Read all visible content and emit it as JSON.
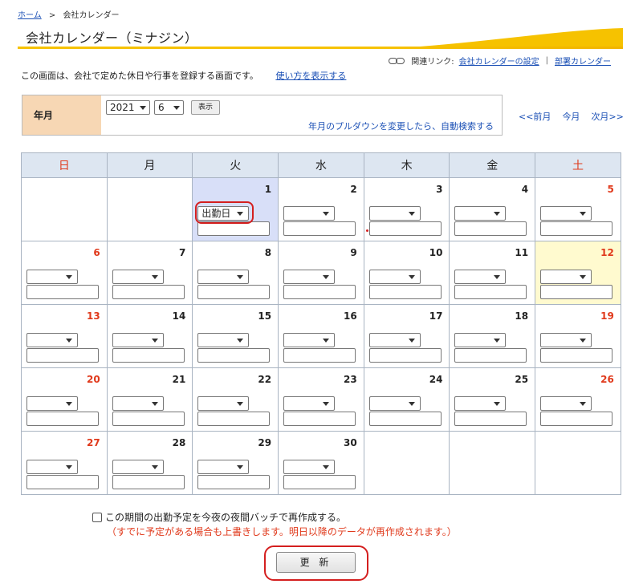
{
  "breadcrumb": {
    "home": "ホーム",
    "sep": ">",
    "current": "会社カレンダー"
  },
  "page_title": "会社カレンダー（ミナジン）",
  "related": {
    "label": "関連リンク:",
    "link1": "会社カレンダーの設定",
    "sep": "|",
    "link2": "部署カレンダー"
  },
  "description": {
    "text": "この画面は、会社で定めた休日や行事を登録する画面です。",
    "howto_link": "使い方を表示する"
  },
  "year_month": {
    "label": "年月",
    "year": "2021",
    "month": "6",
    "show_button": "表示",
    "hint": "年月のプルダウンを変更したら、自動検索する"
  },
  "nav": {
    "prev": "<<前月",
    "this": "今月",
    "next": "次月>>"
  },
  "weekdays": [
    "日",
    "月",
    "火",
    "水",
    "木",
    "金",
    "土"
  ],
  "weeks": [
    [
      {
        "day": ""
      },
      {
        "day": ""
      },
      {
        "day": "1",
        "status": "出勤日"
      },
      {
        "day": "2"
      },
      {
        "day": "3"
      },
      {
        "day": "4"
      },
      {
        "day": "5"
      }
    ],
    [
      {
        "day": "6"
      },
      {
        "day": "7"
      },
      {
        "day": "8"
      },
      {
        "day": "9"
      },
      {
        "day": "10"
      },
      {
        "day": "11"
      },
      {
        "day": "12"
      }
    ],
    [
      {
        "day": "13"
      },
      {
        "day": "14"
      },
      {
        "day": "15"
      },
      {
        "day": "16"
      },
      {
        "day": "17"
      },
      {
        "day": "18"
      },
      {
        "day": "19"
      }
    ],
    [
      {
        "day": "20"
      },
      {
        "day": "21"
      },
      {
        "day": "22"
      },
      {
        "day": "23"
      },
      {
        "day": "24"
      },
      {
        "day": "25"
      },
      {
        "day": "26"
      }
    ],
    [
      {
        "day": "27"
      },
      {
        "day": "28"
      },
      {
        "day": "29"
      },
      {
        "day": "30"
      },
      {
        "day": ""
      },
      {
        "day": ""
      },
      {
        "day": ""
      }
    ]
  ],
  "batch": {
    "checkbox_label": "この期間の出勤予定を今夜の夜間バッチで再作成する。",
    "checked": false
  },
  "warning": "（すでに予定がある場合も上書きします。明日以降のデータが再作成されます。）",
  "update_button": "更 新",
  "colors": {
    "holiday_red": "#e0391b",
    "header_blue": "#dde6f1",
    "today_blue": "#d8dff8",
    "highlight_yellow": "#fffacf",
    "label_orange": "#f7d7b4",
    "title_gold": "#f6c200",
    "link_blue": "#1a4fb5"
  }
}
